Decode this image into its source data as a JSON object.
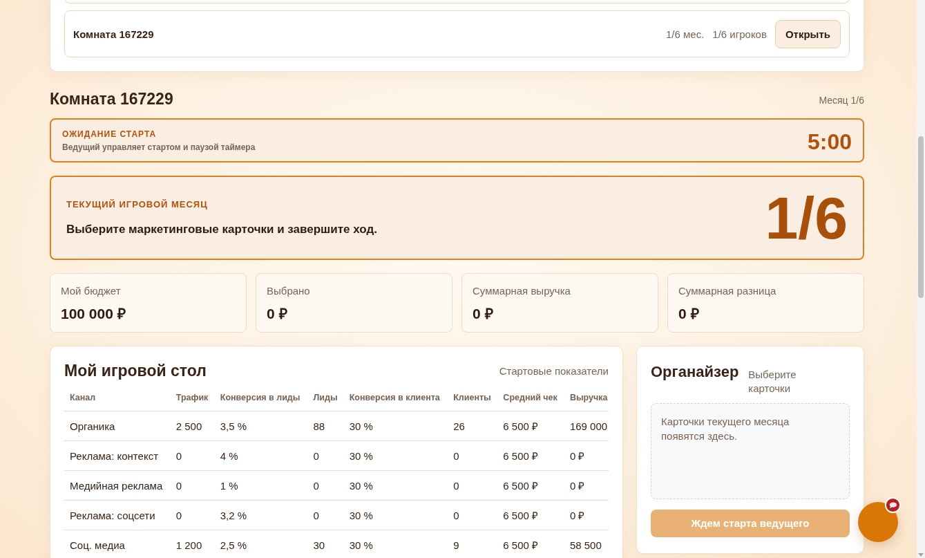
{
  "rooms_panel": {
    "rooms": [
      {
        "name": "Комната 167229",
        "month": "1/6 мес.",
        "players": "1/6 игроков",
        "action": "Открыть"
      }
    ]
  },
  "room": {
    "title": "Комната 167229",
    "month_label": "Месяц 1/6"
  },
  "timer": {
    "status": "ОЖИДАНИЕ СТАРТА",
    "note": "Ведущий управляет стартом и паузой таймера",
    "time": "5:00"
  },
  "current_month": {
    "label": "ТЕКУЩИЙ ИГРОВОЙ МЕСЯЦ",
    "instruction": "Выберите маркетинговые карточки и завершите ход.",
    "value": "1/6"
  },
  "stats": [
    {
      "label": "Мой бюджет",
      "value": "100 000 ₽"
    },
    {
      "label": "Выбрано",
      "value": "0 ₽"
    },
    {
      "label": "Суммарная выручка",
      "value": "0 ₽"
    },
    {
      "label": "Суммарная разница",
      "value": "0 ₽"
    }
  ],
  "game_table": {
    "title": "Мой игровой стол",
    "subtitle": "Стартовые показатели",
    "columns": [
      "Канал",
      "Трафик",
      "Конверсия в лиды",
      "Лиды",
      "Конверсия в клиента",
      "Клиенты",
      "Средний чек",
      "Выручка"
    ],
    "rows": [
      [
        "Органика",
        "2 500",
        "3,5 %",
        "88",
        "30 %",
        "26",
        "6 500 ₽",
        "169 000"
      ],
      [
        "Реклама: контекст",
        "0",
        "4 %",
        "0",
        "30 %",
        "0",
        "6 500 ₽",
        "0 ₽"
      ],
      [
        "Медийная реклама",
        "0",
        "1 %",
        "0",
        "30 %",
        "0",
        "6 500 ₽",
        "0 ₽"
      ],
      [
        "Реклама: соцсети",
        "0",
        "3,2 %",
        "0",
        "30 %",
        "0",
        "6 500 ₽",
        "0 ₽"
      ],
      [
        "Соц. медиа",
        "1 200",
        "2,5 %",
        "30",
        "30 %",
        "9",
        "6 500 ₽",
        "58 500"
      ]
    ]
  },
  "organizer": {
    "title": "Органайзер",
    "hint": "Выберите карточки",
    "empty_text": "Карточки текущего месяца появятся здесь.",
    "button": {
      "label": "Ждем старта ведущего",
      "disabled": true
    }
  },
  "chat": {
    "unread": true
  }
}
